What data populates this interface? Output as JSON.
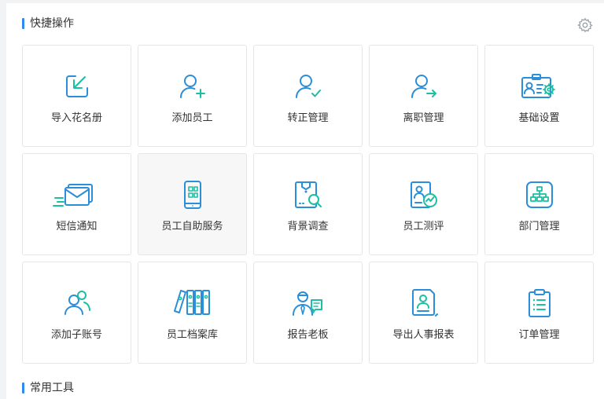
{
  "sections": {
    "quick_actions": "快捷操作",
    "common_tools": "常用工具"
  },
  "settings": {
    "icon": "gear-icon"
  },
  "colors": {
    "accent": "#2d8cf0",
    "icon_blue": "#2b8ed8",
    "icon_green": "#1cbfa2"
  },
  "tiles": [
    {
      "label": "导入花名册",
      "icon": "import-icon"
    },
    {
      "label": "添加员工",
      "icon": "add-user-icon"
    },
    {
      "label": "转正管理",
      "icon": "user-check-icon"
    },
    {
      "label": "离职管理",
      "icon": "user-leave-icon"
    },
    {
      "label": "基础设置",
      "icon": "id-card-settings-icon"
    },
    {
      "label": "短信通知",
      "icon": "sms-envelope-icon"
    },
    {
      "label": "员工自助服务",
      "icon": "mobile-qr-icon"
    },
    {
      "label": "背景调查",
      "icon": "file-search-icon"
    },
    {
      "label": "员工测评",
      "icon": "evaluation-icon"
    },
    {
      "label": "部门管理",
      "icon": "org-chart-icon"
    },
    {
      "label": "添加子账号",
      "icon": "sub-account-icon"
    },
    {
      "label": "员工档案库",
      "icon": "binders-icon"
    },
    {
      "label": "报告老板",
      "icon": "report-boss-icon"
    },
    {
      "label": "导出人事报表",
      "icon": "export-report-icon"
    },
    {
      "label": "订单管理",
      "icon": "clipboard-list-icon"
    }
  ]
}
